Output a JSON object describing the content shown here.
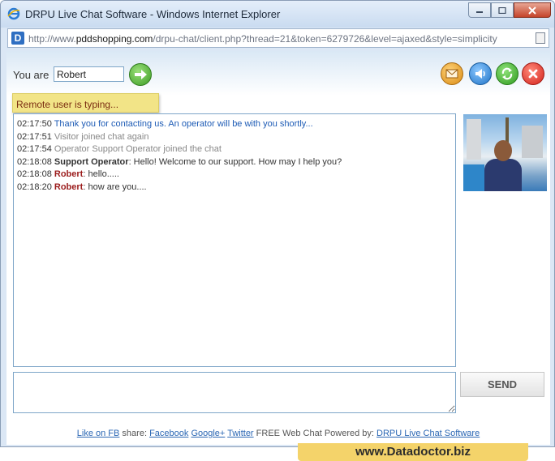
{
  "window": {
    "title": "DRPU Live Chat Software - Windows Internet Explorer",
    "icons": {
      "app": "ie-icon",
      "minimize": "minimize-icon",
      "maximize": "maximize-icon",
      "close": "close-icon"
    }
  },
  "address_bar": {
    "url_prefix": "http://www.",
    "url_domain": "pddshopping.com",
    "url_path": "/drpu-chat/client.php?thread=21&token=6279726&level=ajaxed&style=simplicity"
  },
  "header": {
    "you_are_label": "You are",
    "name_value": "Robert",
    "buttons": {
      "go": "arrow-right-icon",
      "mail": "mail-icon",
      "sound": "speaker-icon",
      "refresh": "refresh-icon",
      "close": "close-icon"
    }
  },
  "status": {
    "typing": "Remote user is typing..."
  },
  "messages": [
    {
      "time": "02:17:50",
      "sender": "",
      "text": "Thank you for contacting us. An operator will be with you shortly...",
      "kind": "system"
    },
    {
      "time": "02:17:51",
      "sender": "",
      "text": "Visitor joined chat again",
      "kind": "info"
    },
    {
      "time": "02:17:54",
      "sender": "",
      "text": "Operator Support Operator joined the chat",
      "kind": "info"
    },
    {
      "time": "02:18:08",
      "sender": "Support Operator",
      "text": ": Hello! Welcome to our support. How may I help you?",
      "kind": "operator"
    },
    {
      "time": "02:18:08",
      "sender": "Robert",
      "text": ": hello.....",
      "kind": "user"
    },
    {
      "time": "02:18:20",
      "sender": "Robert",
      "text": ": how are you....",
      "kind": "user"
    }
  ],
  "composer": {
    "send_label": "SEND"
  },
  "footer": {
    "like_link": "Like on FB",
    "share_label": "share:",
    "facebook_link": "Facebook",
    "google_link": "Google+",
    "twitter_link": "Twitter",
    "powered_text": "FREE Web Chat Powered by:",
    "drpu_link": "DRPU Live Chat Software"
  },
  "brand": {
    "text": "www.Datadoctor.biz"
  },
  "colors": {
    "typing_bg": "#f2e487",
    "system_text": "#1d5bb5",
    "user_name": "#9b1c1c",
    "brand_bg": "#f4d36a"
  }
}
